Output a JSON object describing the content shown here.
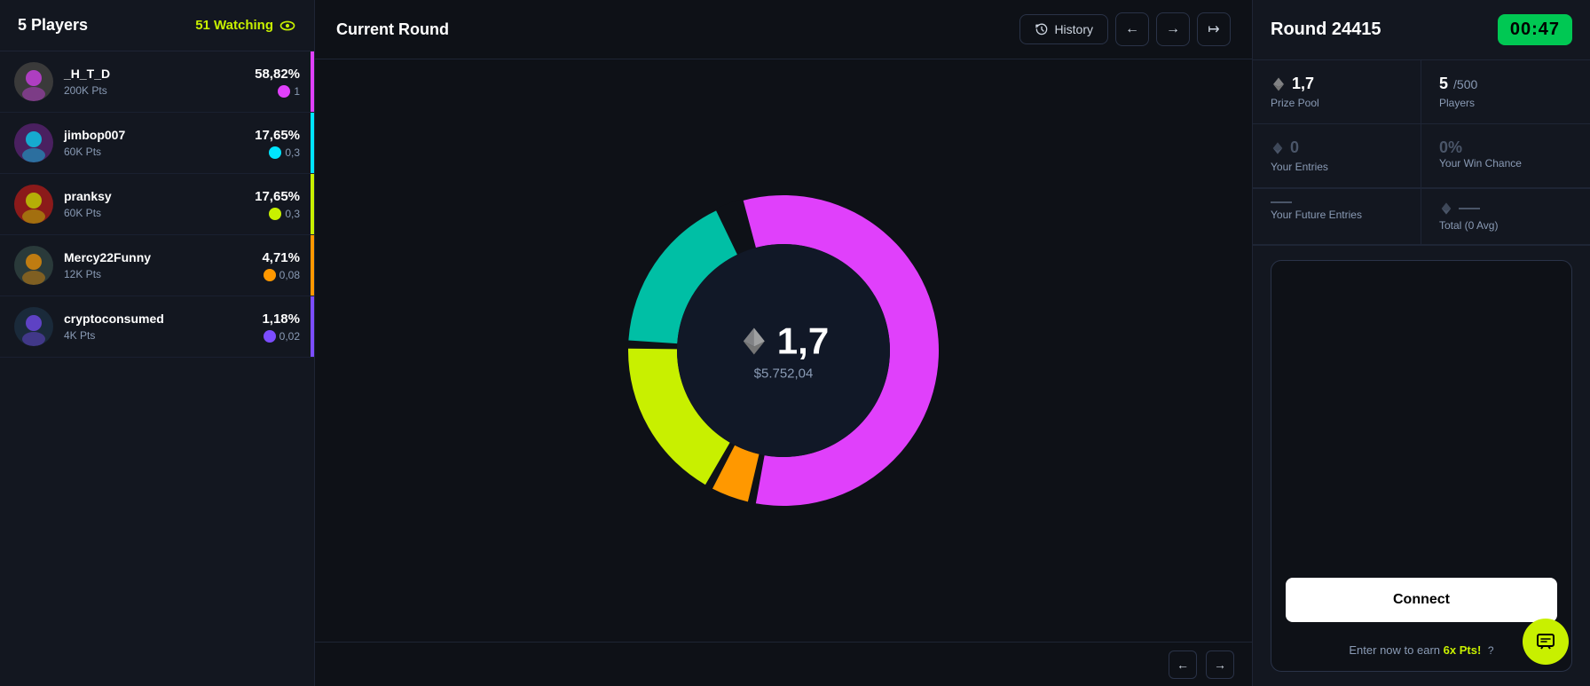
{
  "left": {
    "title": "5 Players",
    "watching_count": "51 Watching",
    "players": [
      {
        "name": "_H_T_D",
        "pts": "200K Pts",
        "pct": "58,82%",
        "eth": "1",
        "bar_color": "#e040fb",
        "avatar_bg": "#3a3a3a",
        "avatar_type": "robot"
      },
      {
        "name": "jimbop007",
        "pts": "60K Pts",
        "pct": "17,65%",
        "eth": "0,3",
        "bar_color": "#00e5ff",
        "avatar_bg": "#4a2060",
        "avatar_type": "pixel"
      },
      {
        "name": "pranksy",
        "pts": "60K Pts",
        "pct": "17,65%",
        "eth": "0,3",
        "bar_color": "#c8f000",
        "avatar_bg": "#8b1a1a",
        "avatar_type": "skull"
      },
      {
        "name": "Mercy22Funny",
        "pts": "12K Pts",
        "pct": "4,71%",
        "eth": "0,08",
        "bar_color": "#ff9800",
        "avatar_bg": "#2a3a3a",
        "avatar_type": "animal"
      },
      {
        "name": "cryptoconsumed",
        "pts": "4K Pts",
        "pct": "1,18%",
        "eth": "0,02",
        "bar_color": "#7c4dff",
        "avatar_bg": "#1a2a3a",
        "avatar_type": "user"
      }
    ]
  },
  "middle": {
    "title": "Current Round",
    "history_label": "History",
    "eth_amount": "1,7",
    "usd_amount": "$5.752,04",
    "chart_segments": [
      {
        "color": "#e040fb",
        "pct": 58.82
      },
      {
        "color": "#ff9800",
        "pct": 4.71
      },
      {
        "color": "#c8f000",
        "pct": 17.65
      },
      {
        "color": "#00bfa5",
        "pct": 17.65
      },
      {
        "color": "#7c4dff",
        "pct": 1.18
      }
    ]
  },
  "right": {
    "round_number": "Round 24415",
    "timer": "00:47",
    "prize_pool_label": "Prize Pool",
    "prize_pool_value": "1,7",
    "players_label": "Players",
    "players_value": "5",
    "players_max": "500",
    "entries_label": "Your Entries",
    "entries_value": "0",
    "win_chance_label": "Your Win Chance",
    "win_chance_value": "0%",
    "future_entries_label": "Your Future Entries",
    "total_label": "Total (0 Avg)",
    "connect_label": "Connect",
    "earn_text": "Enter now to earn",
    "earn_pts": "6x Pts!",
    "question_icon": "?"
  }
}
